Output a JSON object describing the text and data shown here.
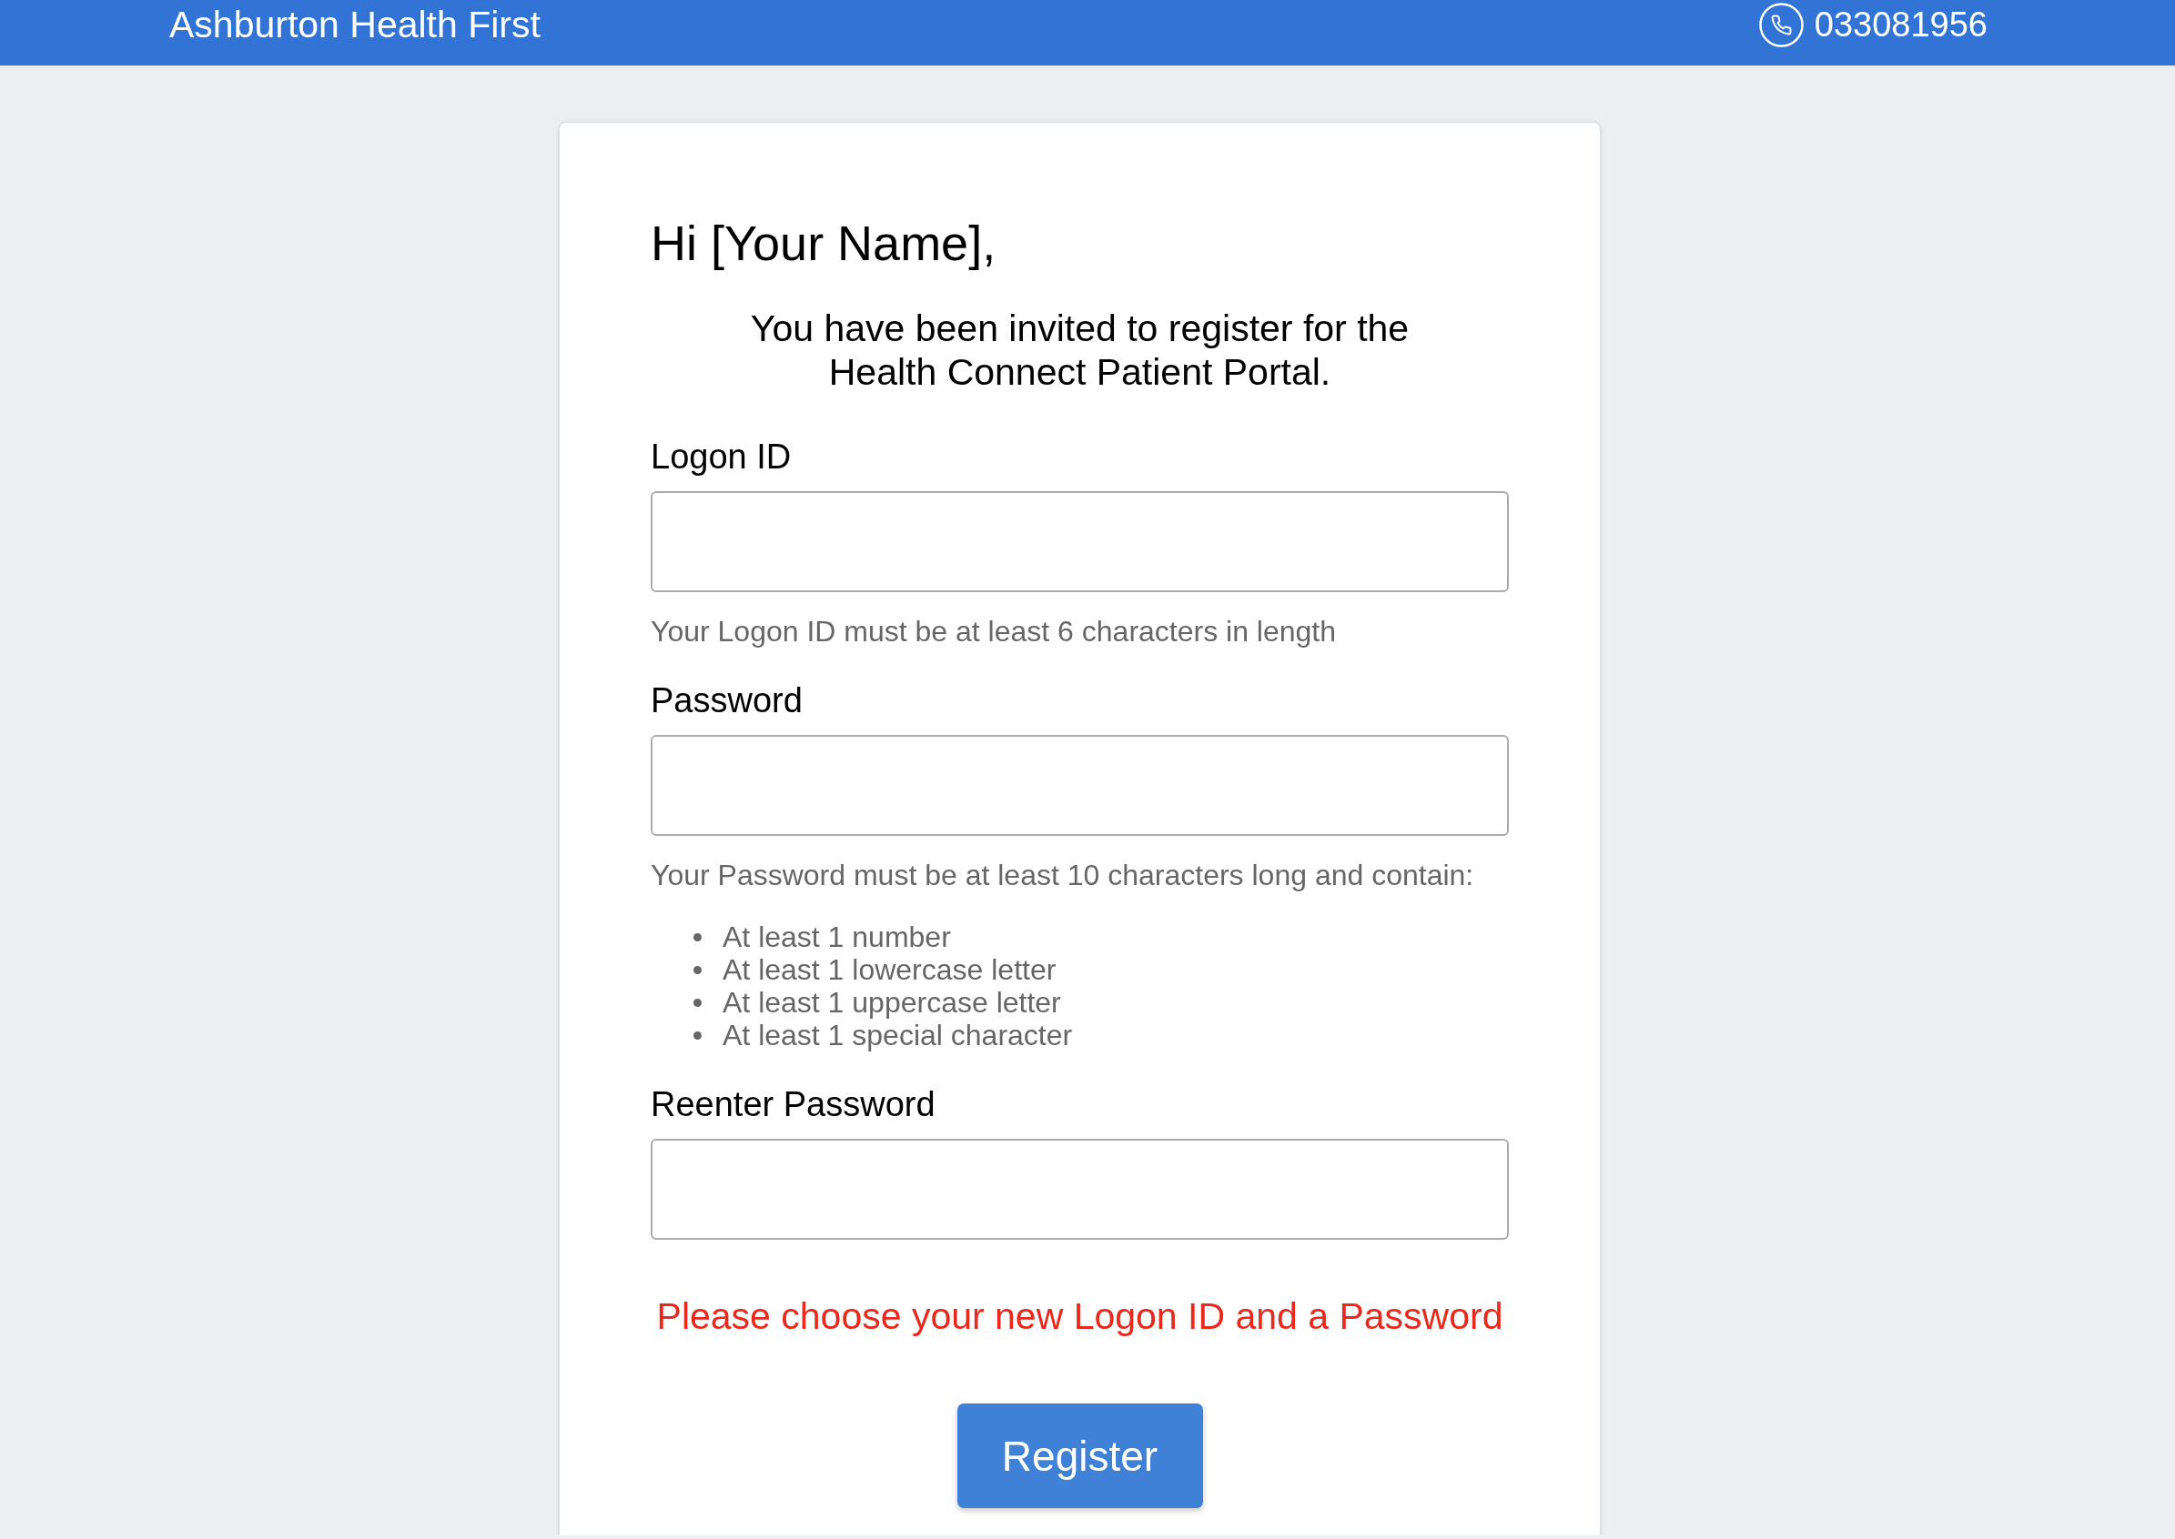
{
  "header": {
    "title": "Ashburton Health First",
    "phone": "033081956"
  },
  "greeting": "Hi [Your Name],",
  "intro": "You have been invited to register for the Health Connect Patient Portal.",
  "fields": [
    {
      "label": "Logon ID",
      "hint": "Your Logon ID must be at least 6 characters in length"
    },
    {
      "label": "Password",
      "hint": "Your Password must be at least 10 characters long and contain:",
      "rules": [
        "At least 1 number",
        "At least 1 lowercase letter",
        "At least 1 uppercase letter",
        "At least 1 special character"
      ]
    },
    {
      "label": "Reenter Password"
    }
  ],
  "error_message": "Please choose your new Logon ID and a Password",
  "submit": {
    "label": "Register"
  }
}
